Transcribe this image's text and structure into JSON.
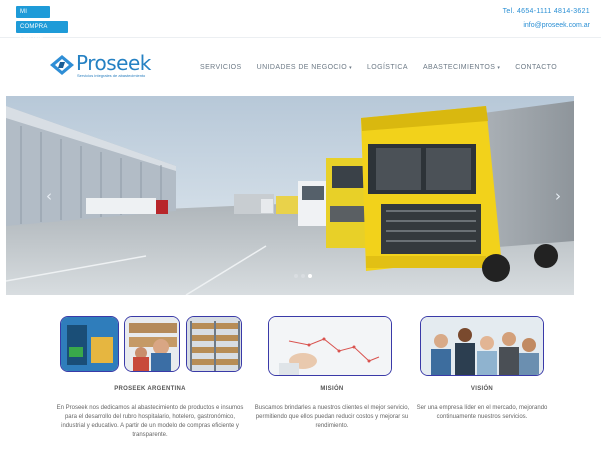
{
  "topbar": {
    "account_label": "MI CUENTA",
    "shop_label": "COMPRA ONLINE",
    "phone": "Tel. 4654-1111 4814-3621",
    "email": "info@proseek.com.ar"
  },
  "brand": {
    "name": "Proseek",
    "tagline": "Servicios integrales de abastecimiento",
    "color": "#2581c3"
  },
  "nav": {
    "items": [
      {
        "label": "SERVICIOS",
        "has_dropdown": false
      },
      {
        "label": "UNIDADES DE NEGOCIO",
        "has_dropdown": true
      },
      {
        "label": "LOGÍSTICA",
        "has_dropdown": false
      },
      {
        "label": "ABASTECIMIENTOS",
        "has_dropdown": true
      },
      {
        "label": "CONTACTO",
        "has_dropdown": false
      }
    ]
  },
  "slider": {
    "prev_icon": "chevron-left-icon",
    "next_icon": "chevron-right-icon",
    "slides": 3,
    "active_slide": 3
  },
  "features": [
    {
      "title": "PROSEEK ARGENTINA",
      "text": "En Proseek nos dedicamos al abastecimiento de productos e insumos para el desarrollo del rubro hospitalario, hotelero, gastronómico, industrial y educativo. A partir de un modelo de compras eficiente y transparente."
    },
    {
      "title": "MISIÓN",
      "text": "Buscamos brindarles a nuestros clientes el mejor servicio, permitiendo que ellos puedan reducir costos y mejorar su rendimiento."
    },
    {
      "title": "VISIÓN",
      "text": "Ser una empresa líder en el mercado, mejorando continuamente nuestros servicios."
    }
  ],
  "colors": {
    "accent": "#1e9bd8",
    "card_border": "#3a3aa8"
  }
}
